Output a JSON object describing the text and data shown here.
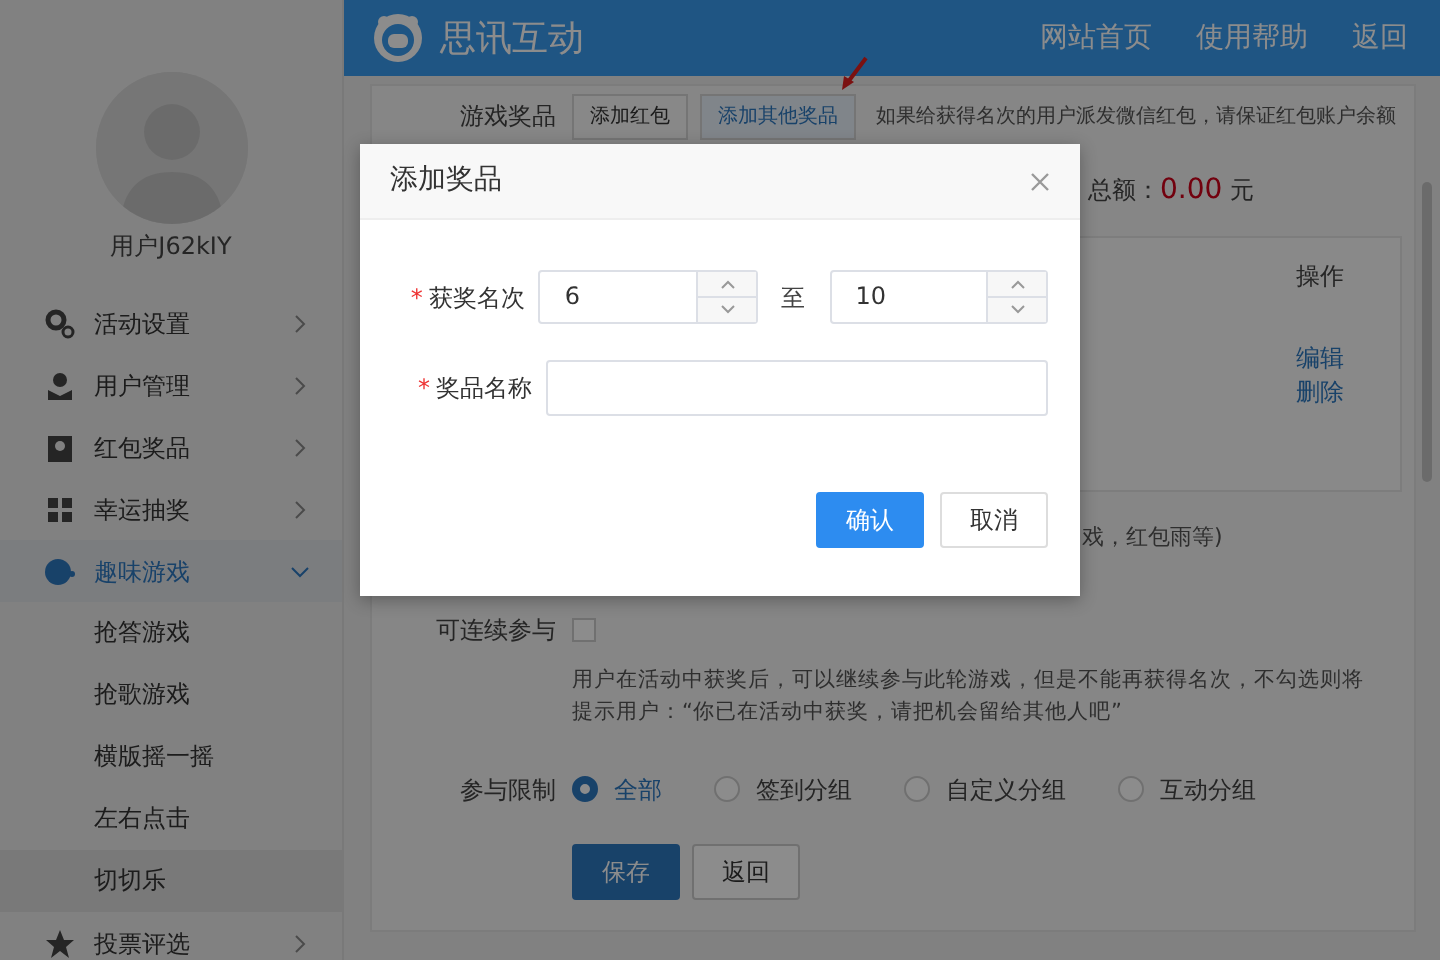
{
  "header": {
    "logo_text": "思讯互动",
    "nav": [
      "网站首页",
      "使用帮助",
      "返回"
    ]
  },
  "sidebar": {
    "username": "用户J62kIY",
    "items": [
      {
        "label": "活动设置",
        "expanded": false,
        "selected": false
      },
      {
        "label": "用户管理",
        "expanded": false,
        "selected": false
      },
      {
        "label": "红包奖品",
        "expanded": false,
        "selected": false
      },
      {
        "label": "幸运抽奖",
        "expanded": false,
        "selected": false
      },
      {
        "label": "趣味游戏",
        "expanded": true,
        "selected": true,
        "children": [
          {
            "label": "抢答游戏",
            "selected": false
          },
          {
            "label": "抢歌游戏",
            "selected": false
          },
          {
            "label": "横版摇一摇",
            "selected": false
          },
          {
            "label": "左右点击",
            "selected": false
          },
          {
            "label": "切切乐",
            "selected": true
          }
        ]
      },
      {
        "label": "投票评选",
        "expanded": false,
        "selected": false
      }
    ]
  },
  "content": {
    "prize_label": "游戏奖品",
    "tabs": [
      {
        "label": "添加红包",
        "selected": false
      },
      {
        "label": "添加其他奖品",
        "selected": true
      }
    ],
    "notice": "如果给获得名次的用户派发微信红包，请保证红包账户余额",
    "total_label": "总额：",
    "total_value": "0.00",
    "total_unit": "元",
    "table_header": "操作",
    "actions": [
      "编辑",
      "删除"
    ],
    "partial_note": "戏，红包雨等)",
    "repeat_label": "可连续参与",
    "repeat_checked": false,
    "repeat_note": "用户在活动中获奖后，可以继续参与此轮游戏，但是不能再获得名次，不勾选则将提示用户：“你已在活动中获奖，请把机会留给其他人吧”",
    "limit_label": "参与限制",
    "limit_options": [
      {
        "label": "全部",
        "selected": true
      },
      {
        "label": "签到分组",
        "selected": false
      },
      {
        "label": "自定义分组",
        "selected": false
      },
      {
        "label": "互动分组",
        "selected": false
      }
    ],
    "buttons": [
      {
        "label": "保存",
        "kind": "primary"
      },
      {
        "label": "返回",
        "kind": "default"
      }
    ]
  },
  "modal": {
    "title": "添加奖品",
    "fields": [
      {
        "kind": "range",
        "mark": "*",
        "label": "获奖名次",
        "from": "6",
        "separator": "至",
        "to": "10"
      },
      {
        "kind": "text",
        "mark": "*",
        "label": "奖品名称"
      }
    ],
    "buttons": [
      {
        "label": "确认",
        "kind": "primary"
      },
      {
        "label": "取消",
        "kind": "default"
      }
    ]
  }
}
